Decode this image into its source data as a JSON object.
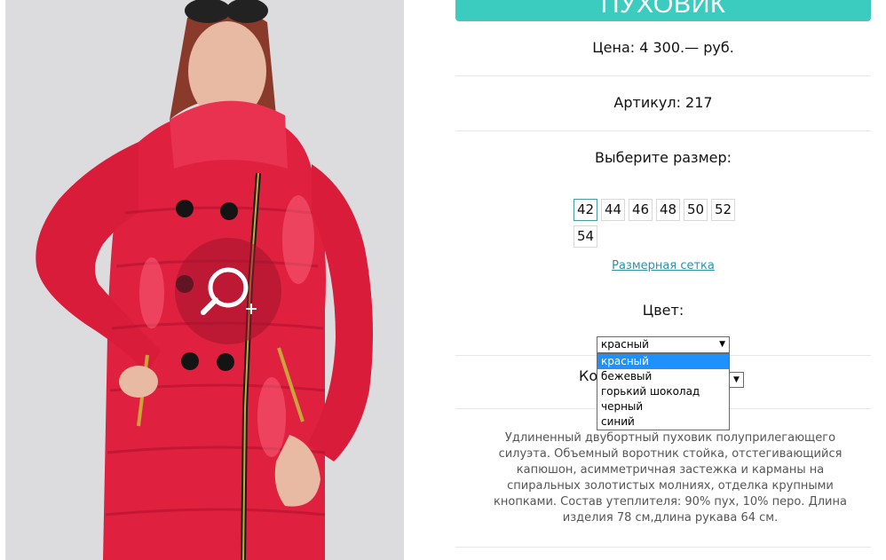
{
  "product": {
    "title": "ПУХОВИК",
    "price": "Цена: 4 300.— руб.",
    "article": "Артикул: 217",
    "size_heading": "Выберите размер:",
    "sizes": [
      "42",
      "44",
      "46",
      "48",
      "50",
      "52",
      "54"
    ],
    "selected_size": "42",
    "size_chart_link": "Размерная сетка",
    "color_heading": "Цвет:",
    "color_select_value": "красный",
    "color_options": [
      "красный",
      "бежевый",
      "горький шоколад",
      "черный",
      "синий"
    ],
    "quantity_label_visible": "Ко",
    "description": "Удлиненный двубортный пуховик полуприлегающего силуэта. Объемный воротник стойка, отстегивающийся капюшон, асимметричная застежка и карманы на спиральных золотистых молниях, отделка крупными кнопками. Состав утеплителя: 90% пух, 10% перо. Длина изделия 78 см,длина рукава 64 см."
  },
  "icons": {
    "zoom": "zoom-in-icon",
    "dropdown_arrow": "chevron-down-icon"
  },
  "colors": {
    "accent": "#3ccbbf",
    "link": "#2f8fa8",
    "selected_option": "#1e90ff",
    "jacket": "#e0203f"
  }
}
